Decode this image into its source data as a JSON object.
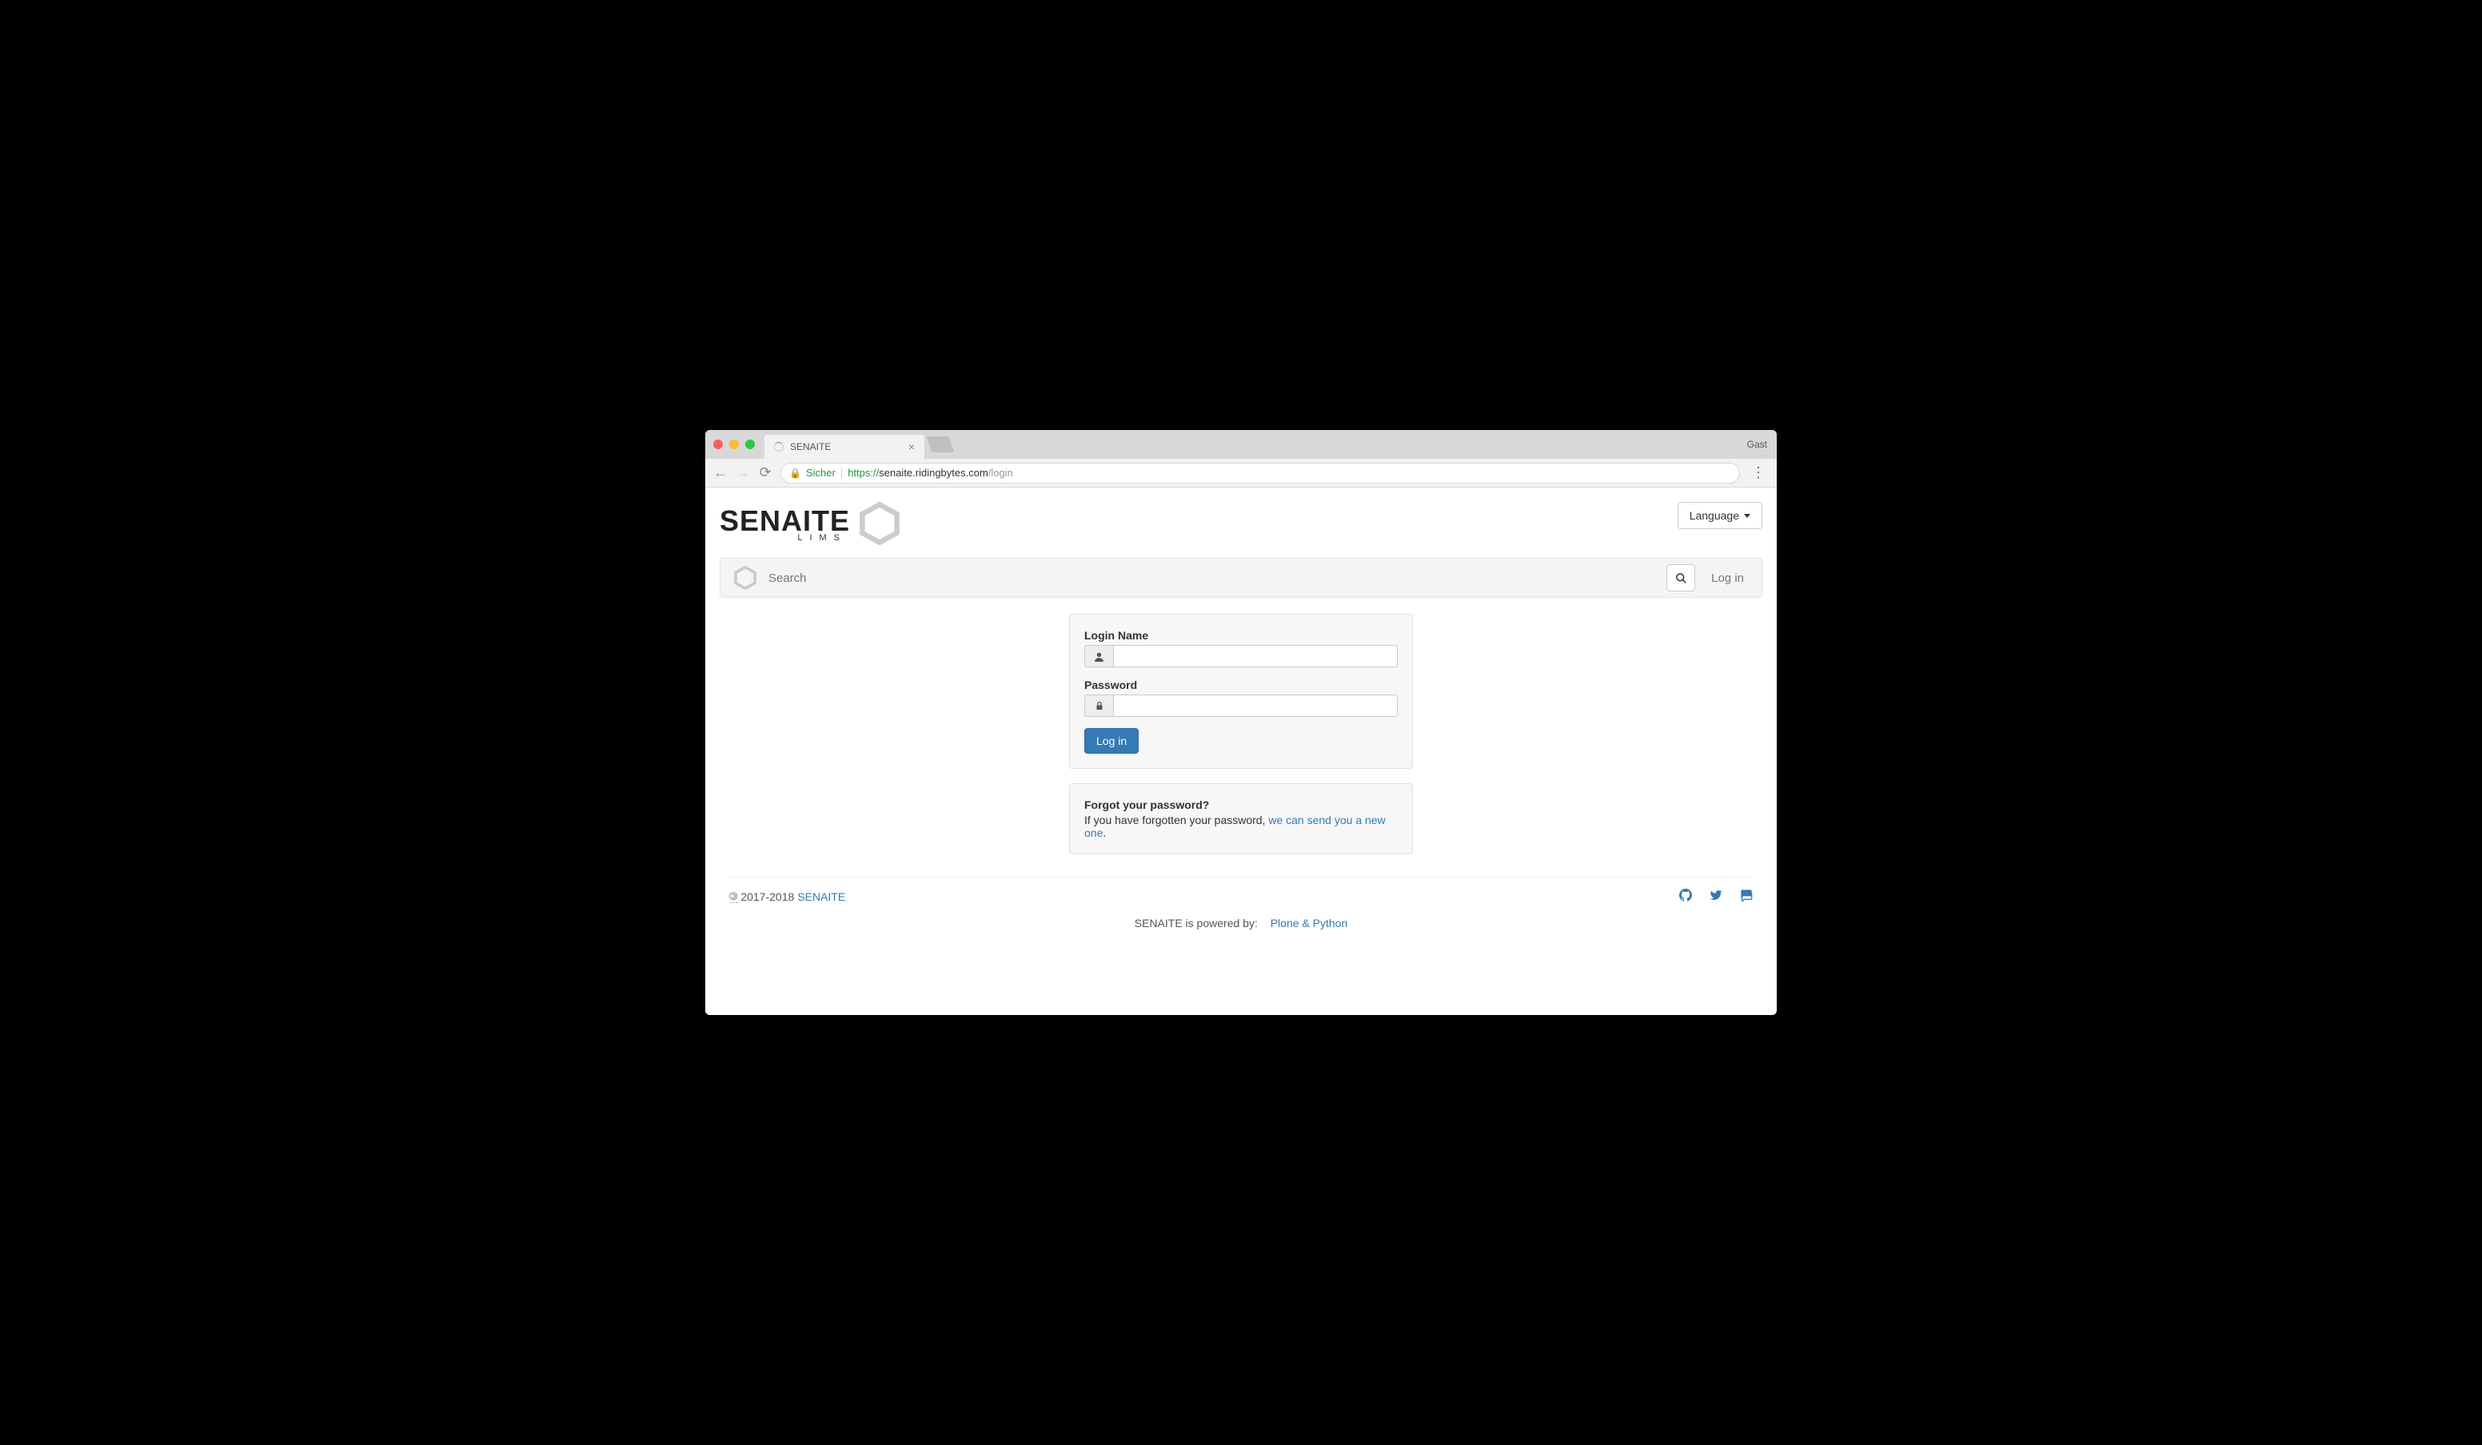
{
  "browser": {
    "tab_title": "SENAITE",
    "guest_label": "Gast",
    "secure_label": "Sicher",
    "url_scheme": "https://",
    "url_host": "senaite.ridingbytes.com",
    "url_path": "/login"
  },
  "header": {
    "logo_main": "SENAITE",
    "logo_sub": "LIMS",
    "language_label": "Language"
  },
  "toolbar": {
    "search_placeholder": "Search",
    "login_link": "Log in"
  },
  "login_form": {
    "login_name_label": "Login Name",
    "password_label": "Password",
    "submit_label": "Log in"
  },
  "forgot_panel": {
    "title": "Forgot your password?",
    "text_prefix": "If you have forgotten your password, ",
    "link_text": "we can send you a new one",
    "text_suffix": "."
  },
  "footer": {
    "copyright_years": "2017-2018",
    "brand_link": "SENAITE",
    "powered_text": "SENAITE is powered by:",
    "powered_link": "Plone & Python"
  }
}
